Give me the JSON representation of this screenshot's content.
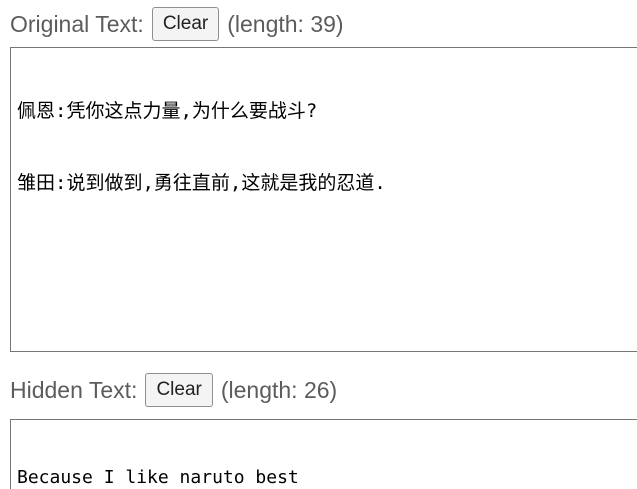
{
  "original": {
    "label": "Original Text:",
    "clear_label": "Clear",
    "length_text": "(length: 39)",
    "lines": [
      "佩恩:凭你这点力量,为什么要战斗?",
      "雏田:说到做到,勇往直前,这就是我的忍道."
    ]
  },
  "hidden": {
    "label": "Hidden Text:",
    "clear_label": "Clear",
    "length_text": "(length: 26)",
    "lines": [
      "Because I like naruto best"
    ]
  }
}
